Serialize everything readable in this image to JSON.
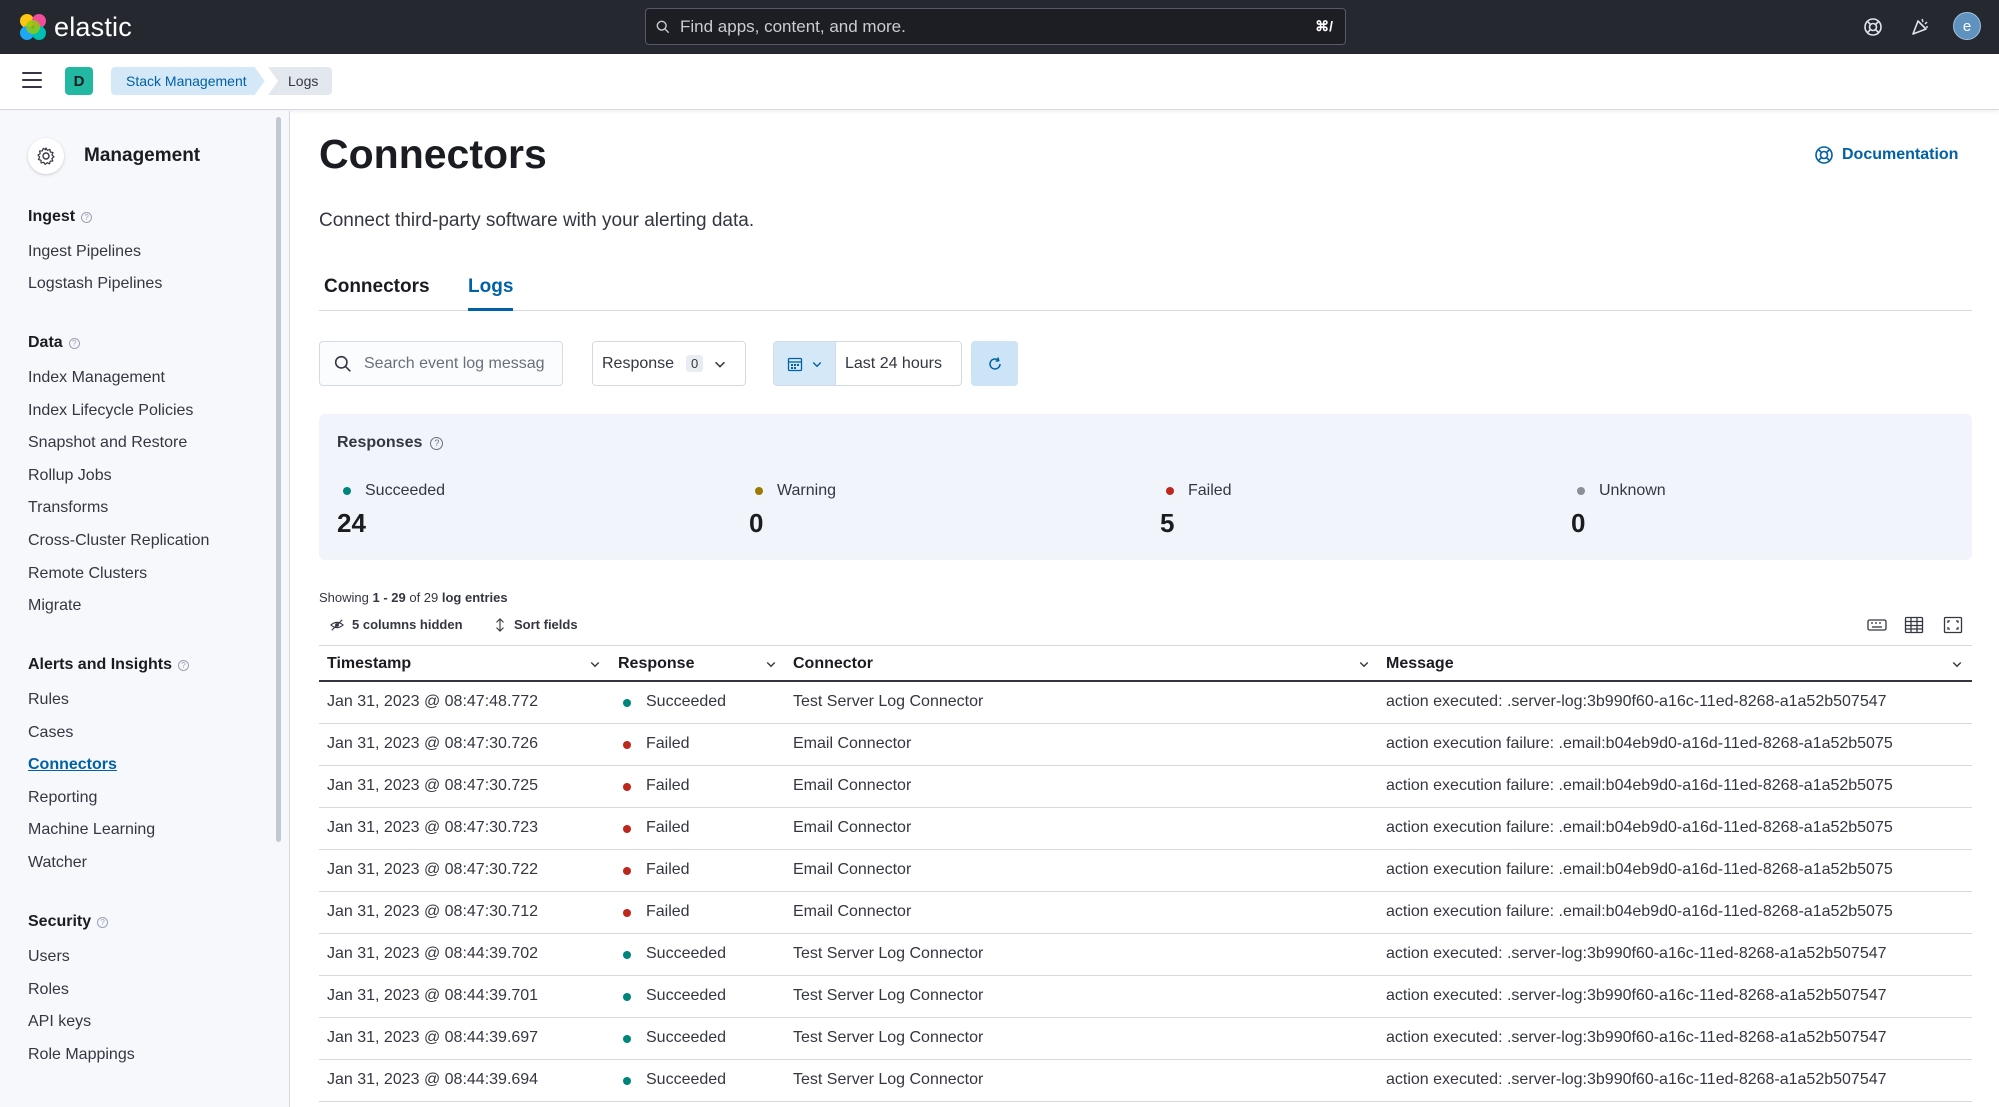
{
  "header": {
    "logo_text": "elastic",
    "search_placeholder": "Find apps, content, and more.",
    "search_shortcut": "⌘/",
    "icons": [
      "help-icon",
      "newsfeed-icon"
    ],
    "user_initial": "e"
  },
  "crumbbar": {
    "space_initial": "D",
    "breadcrumbs": [
      "Stack Management",
      "Logs"
    ]
  },
  "sidebar": {
    "title": "Management",
    "groups": [
      {
        "label": "Ingest",
        "items": [
          "Ingest Pipelines",
          "Logstash Pipelines"
        ]
      },
      {
        "label": "Data",
        "items": [
          "Index Management",
          "Index Lifecycle Policies",
          "Snapshot and Restore",
          "Rollup Jobs",
          "Transforms",
          "Cross-Cluster Replication",
          "Remote Clusters",
          "Migrate"
        ]
      },
      {
        "label": "Alerts and Insights",
        "items": [
          "Rules",
          "Cases",
          "Connectors",
          "Reporting",
          "Machine Learning",
          "Watcher"
        ]
      },
      {
        "label": "Security",
        "items": [
          "Users",
          "Roles",
          "API keys",
          "Role Mappings"
        ]
      }
    ],
    "active_item": "Connectors"
  },
  "main": {
    "title": "Connectors",
    "documentation_link": "Documentation",
    "subtitle": "Connect third-party software with your alerting data.",
    "tabs": [
      {
        "label": "Connectors",
        "active": false
      },
      {
        "label": "Logs",
        "active": true
      }
    ],
    "search_placeholder": "Search event log message",
    "response_filter": {
      "label": "Response",
      "count": "0"
    },
    "date_range": "Last 24 hours",
    "responses": {
      "title": "Responses",
      "stats": [
        {
          "label": "Succeeded",
          "value": "24",
          "color": "#00857a"
        },
        {
          "label": "Warning",
          "value": "0",
          "color": "#9b7b00"
        },
        {
          "label": "Failed",
          "value": "5",
          "color": "#bd271e"
        },
        {
          "label": "Unknown",
          "value": "0",
          "color": "#8c8f96"
        }
      ]
    },
    "showing": {
      "prefix": "Showing ",
      "range": "1 - 29",
      "mid": " of 29 ",
      "suffix": "log entries"
    },
    "grid_tools": {
      "columns_hidden": "5 columns hidden",
      "sort_fields": "Sort fields"
    },
    "columns": [
      "Timestamp",
      "Response",
      "Connector",
      "Message"
    ],
    "rows": [
      {
        "timestamp": "Jan 31, 2023 @ 08:47:48.772",
        "response": "Succeeded",
        "connector": "Test Server Log Connector",
        "message": "action executed: .server-log:3b990f60-a16c-11ed-8268-a1a52b507547"
      },
      {
        "timestamp": "Jan 31, 2023 @ 08:47:30.726",
        "response": "Failed",
        "connector": "Email Connector",
        "message": "action execution failure: .email:b04eb9d0-a16d-11ed-8268-a1a52b5075"
      },
      {
        "timestamp": "Jan 31, 2023 @ 08:47:30.725",
        "response": "Failed",
        "connector": "Email Connector",
        "message": "action execution failure: .email:b04eb9d0-a16d-11ed-8268-a1a52b5075"
      },
      {
        "timestamp": "Jan 31, 2023 @ 08:47:30.723",
        "response": "Failed",
        "connector": "Email Connector",
        "message": "action execution failure: .email:b04eb9d0-a16d-11ed-8268-a1a52b5075"
      },
      {
        "timestamp": "Jan 31, 2023 @ 08:47:30.722",
        "response": "Failed",
        "connector": "Email Connector",
        "message": "action execution failure: .email:b04eb9d0-a16d-11ed-8268-a1a52b5075"
      },
      {
        "timestamp": "Jan 31, 2023 @ 08:47:30.712",
        "response": "Failed",
        "connector": "Email Connector",
        "message": "action execution failure: .email:b04eb9d0-a16d-11ed-8268-a1a52b5075"
      },
      {
        "timestamp": "Jan 31, 2023 @ 08:44:39.702",
        "response": "Succeeded",
        "connector": "Test Server Log Connector",
        "message": "action executed: .server-log:3b990f60-a16c-11ed-8268-a1a52b507547"
      },
      {
        "timestamp": "Jan 31, 2023 @ 08:44:39.701",
        "response": "Succeeded",
        "connector": "Test Server Log Connector",
        "message": "action executed: .server-log:3b990f60-a16c-11ed-8268-a1a52b507547"
      },
      {
        "timestamp": "Jan 31, 2023 @ 08:44:39.697",
        "response": "Succeeded",
        "connector": "Test Server Log Connector",
        "message": "action executed: .server-log:3b990f60-a16c-11ed-8268-a1a52b507547"
      },
      {
        "timestamp": "Jan 31, 2023 @ 08:44:39.694",
        "response": "Succeeded",
        "connector": "Test Server Log Connector",
        "message": "action executed: .server-log:3b990f60-a16c-11ed-8268-a1a52b507547"
      }
    ]
  }
}
